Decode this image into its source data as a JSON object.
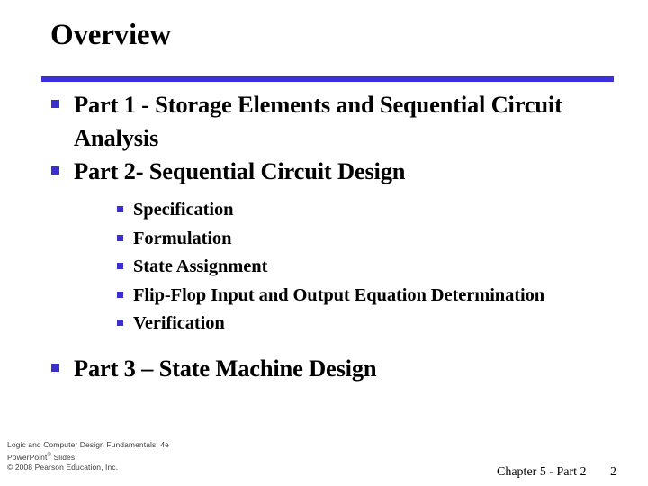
{
  "slide": {
    "title": "Overview",
    "accent_color": "#3b2fe0",
    "bullet_color": "#3a2fcf",
    "background_color": "#ffffff",
    "text_color": "#000000"
  },
  "content": {
    "items": [
      {
        "level": 1,
        "text": "Part 1 - Storage Elements and Sequential Circuit Analysis"
      },
      {
        "level": 1,
        "text": "Part 2- Sequential Circuit Design"
      },
      {
        "level": 2,
        "text": "Specification"
      },
      {
        "level": 2,
        "text": "Formulation"
      },
      {
        "level": 2,
        "text": "State Assignment"
      },
      {
        "level": 2,
        "text": "Flip-Flop Input and Output Equation Determination"
      },
      {
        "level": 2,
        "text": "Verification"
      },
      {
        "level": 1,
        "text": "Part 3 – State Machine Design"
      }
    ]
  },
  "footer": {
    "line1": "Logic and Computer Design Fundamentals, 4e",
    "line2_prefix": "PowerPoint",
    "line2_mark": "®",
    "line2_suffix": " Slides",
    "line3": "© 2008 Pearson Education, Inc.",
    "chapter": "Chapter 5 - Part 2",
    "slide_number": "2"
  }
}
